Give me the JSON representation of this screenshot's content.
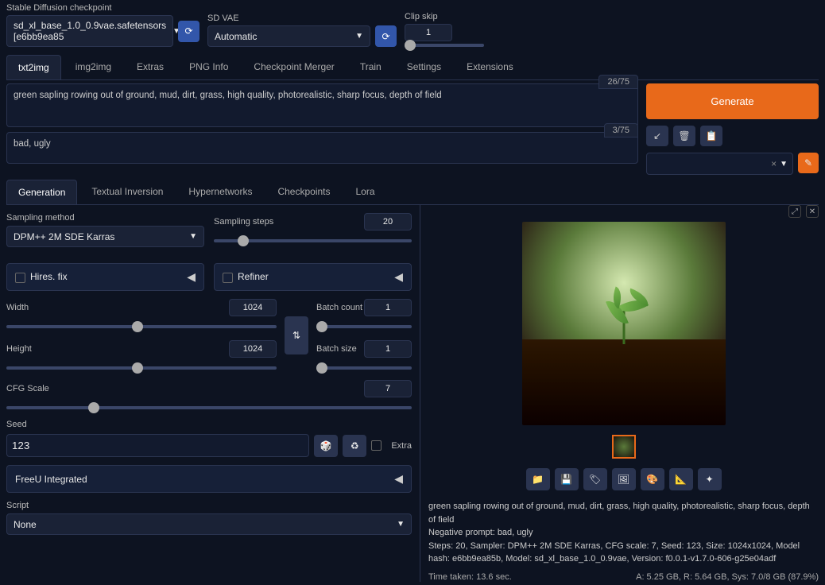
{
  "top": {
    "checkpoint_label": "Stable Diffusion checkpoint",
    "checkpoint_value": "sd_xl_base_1.0_0.9vae.safetensors [e6bb9ea85",
    "vae_label": "SD VAE",
    "vae_value": "Automatic",
    "clip_label": "Clip skip",
    "clip_value": "1"
  },
  "main_tabs": [
    "txt2img",
    "img2img",
    "Extras",
    "PNG Info",
    "Checkpoint Merger",
    "Train",
    "Settings",
    "Extensions"
  ],
  "prompt": {
    "positive": "green sapling rowing out of ground, mud, dirt, grass, high quality, photorealistic, sharp focus, depth of field",
    "pos_count": "26/75",
    "negative": "bad, ugly",
    "neg_count": "3/75"
  },
  "generate_label": "Generate",
  "styles_x": "×",
  "sub_tabs": [
    "Generation",
    "Textual Inversion",
    "Hypernetworks",
    "Checkpoints",
    "Lora"
  ],
  "sampling": {
    "method_label": "Sampling method",
    "method_value": "DPM++ 2M SDE Karras",
    "steps_label": "Sampling steps",
    "steps_value": "20"
  },
  "hires_label": "Hires. fix",
  "refiner_label": "Refiner",
  "dims": {
    "width_label": "Width",
    "width_value": "1024",
    "height_label": "Height",
    "height_value": "1024",
    "batch_count_label": "Batch count",
    "batch_count_value": "1",
    "batch_size_label": "Batch size",
    "batch_size_value": "1"
  },
  "cfg": {
    "label": "CFG Scale",
    "value": "7"
  },
  "seed": {
    "label": "Seed",
    "value": "123",
    "extra_label": "Extra"
  },
  "freeu_label": "FreeU Integrated",
  "script": {
    "label": "Script",
    "value": "None"
  },
  "info": {
    "line1": "green sapling rowing out of ground, mud, dirt, grass, high quality, photorealistic, sharp focus, depth of field",
    "line2": "Negative prompt: bad, ugly",
    "line3": "Steps: 20, Sampler: DPM++ 2M SDE Karras, CFG scale: 7, Seed: 123, Size: 1024x1024, Model hash: e6bb9ea85b, Model: sd_xl_base_1.0_0.9vae, Version: f0.0.1-v1.7.0-606-g25e04adf"
  },
  "footer": {
    "time": "Time taken: 13.6 sec.",
    "mem": "A: 5.25 GB, R: 5.64 GB, Sys: 7.0/8 GB (87.9%)"
  },
  "icons": {
    "refresh": "⟳",
    "arrow": "↙",
    "trash": "🗑",
    "clipboard": "📋",
    "pencil": "✎",
    "chevron": "▼",
    "tri": "◀",
    "swap": "⇅",
    "dice": "🎲",
    "recycle": "♻",
    "folder": "📁",
    "save": "💾",
    "zip": "🏷",
    "grid": "🖼",
    "palette": "🎨",
    "ruler": "📐",
    "star": "✦",
    "expand": "⤢",
    "close": "✕"
  }
}
